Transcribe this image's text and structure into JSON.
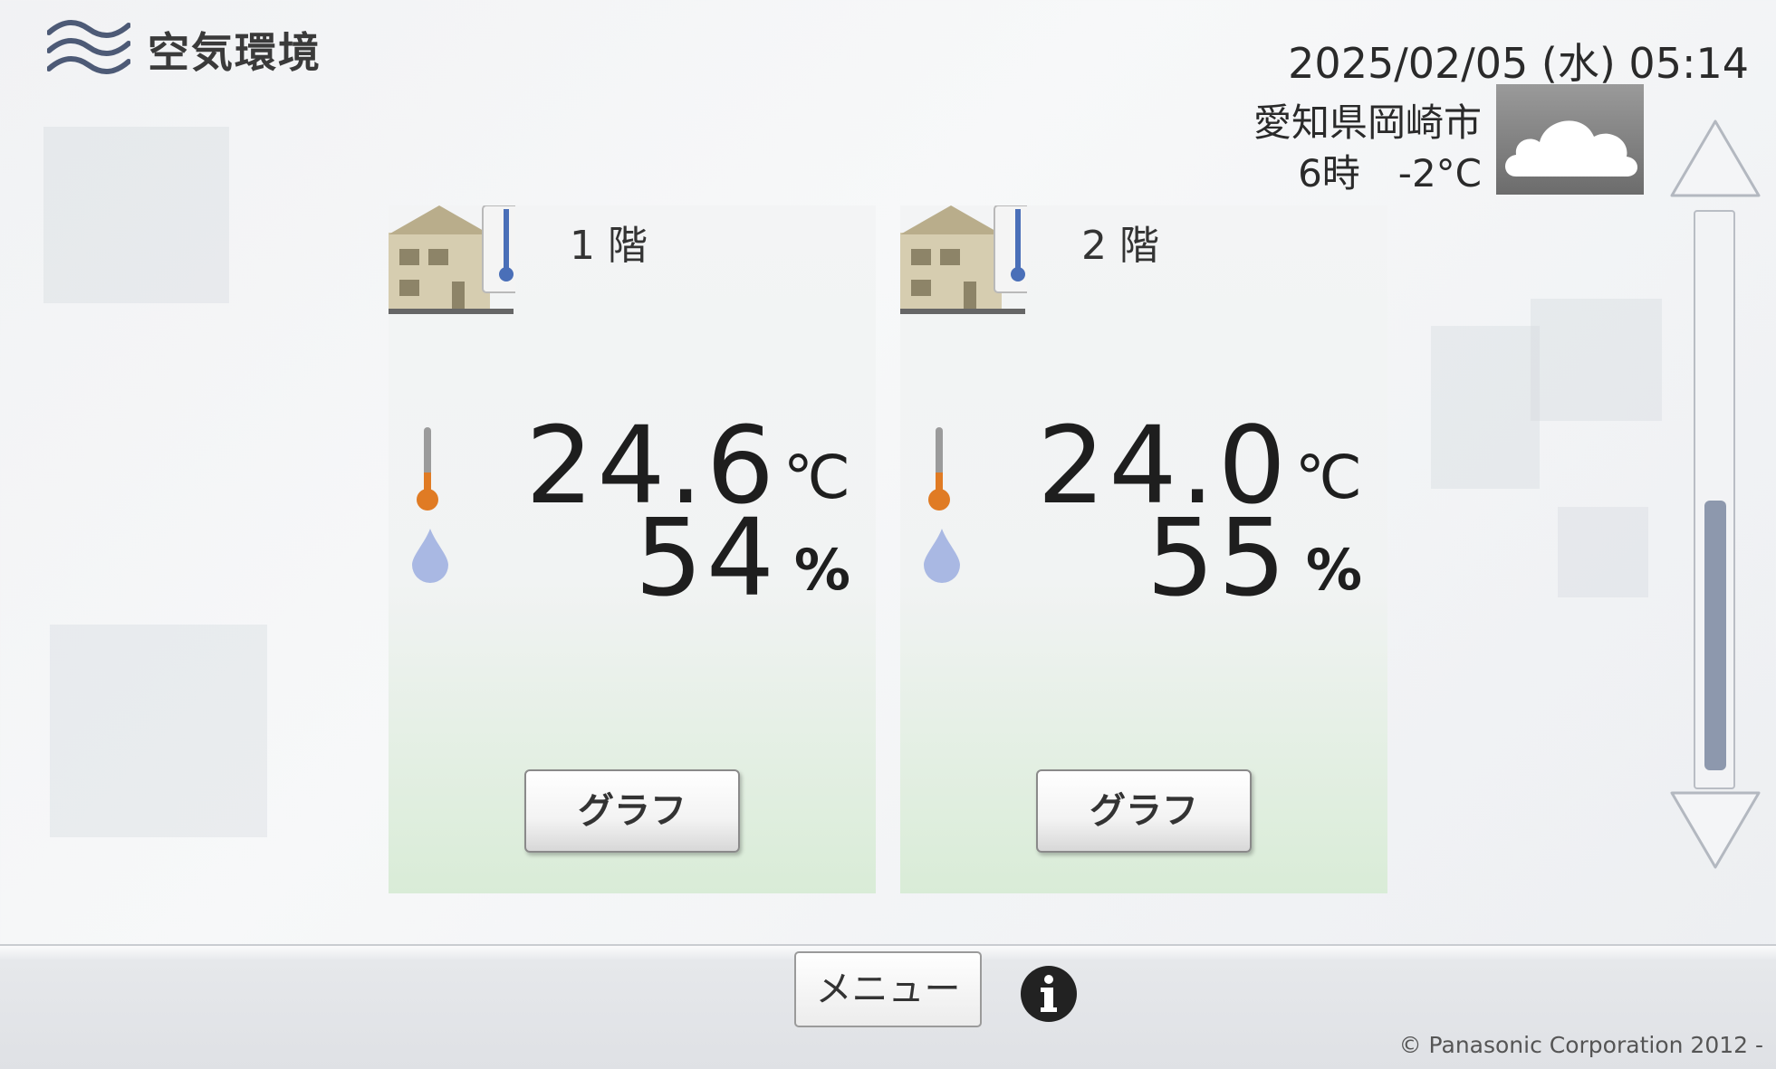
{
  "header": {
    "app_icon": "air-waves-icon",
    "title": "空気環境",
    "datetime": "2025/02/05 (水) 05:14"
  },
  "weather": {
    "location": "愛知県岡崎市",
    "line": "6時　-2°C",
    "icon": "cloud-icon"
  },
  "panels": [
    {
      "floor": "1 階",
      "temperature": "24.6",
      "temp_unit": "℃",
      "humidity": "54",
      "hum_unit": "%",
      "graph_label": "グラフ"
    },
    {
      "floor": "2 階",
      "temperature": "24.0",
      "temp_unit": "℃",
      "humidity": "55",
      "hum_unit": "%",
      "graph_label": "グラフ"
    }
  ],
  "footer": {
    "menu_label": "メニュー",
    "info_icon": "info-icon",
    "copyright": "© Panasonic Corporation 2012 -"
  },
  "colors": {
    "thermometer": "#e07b24",
    "drop": "#a9b8e3",
    "scroll_thumb": "#8d98ad",
    "panel_green": "#d9ecd7"
  }
}
